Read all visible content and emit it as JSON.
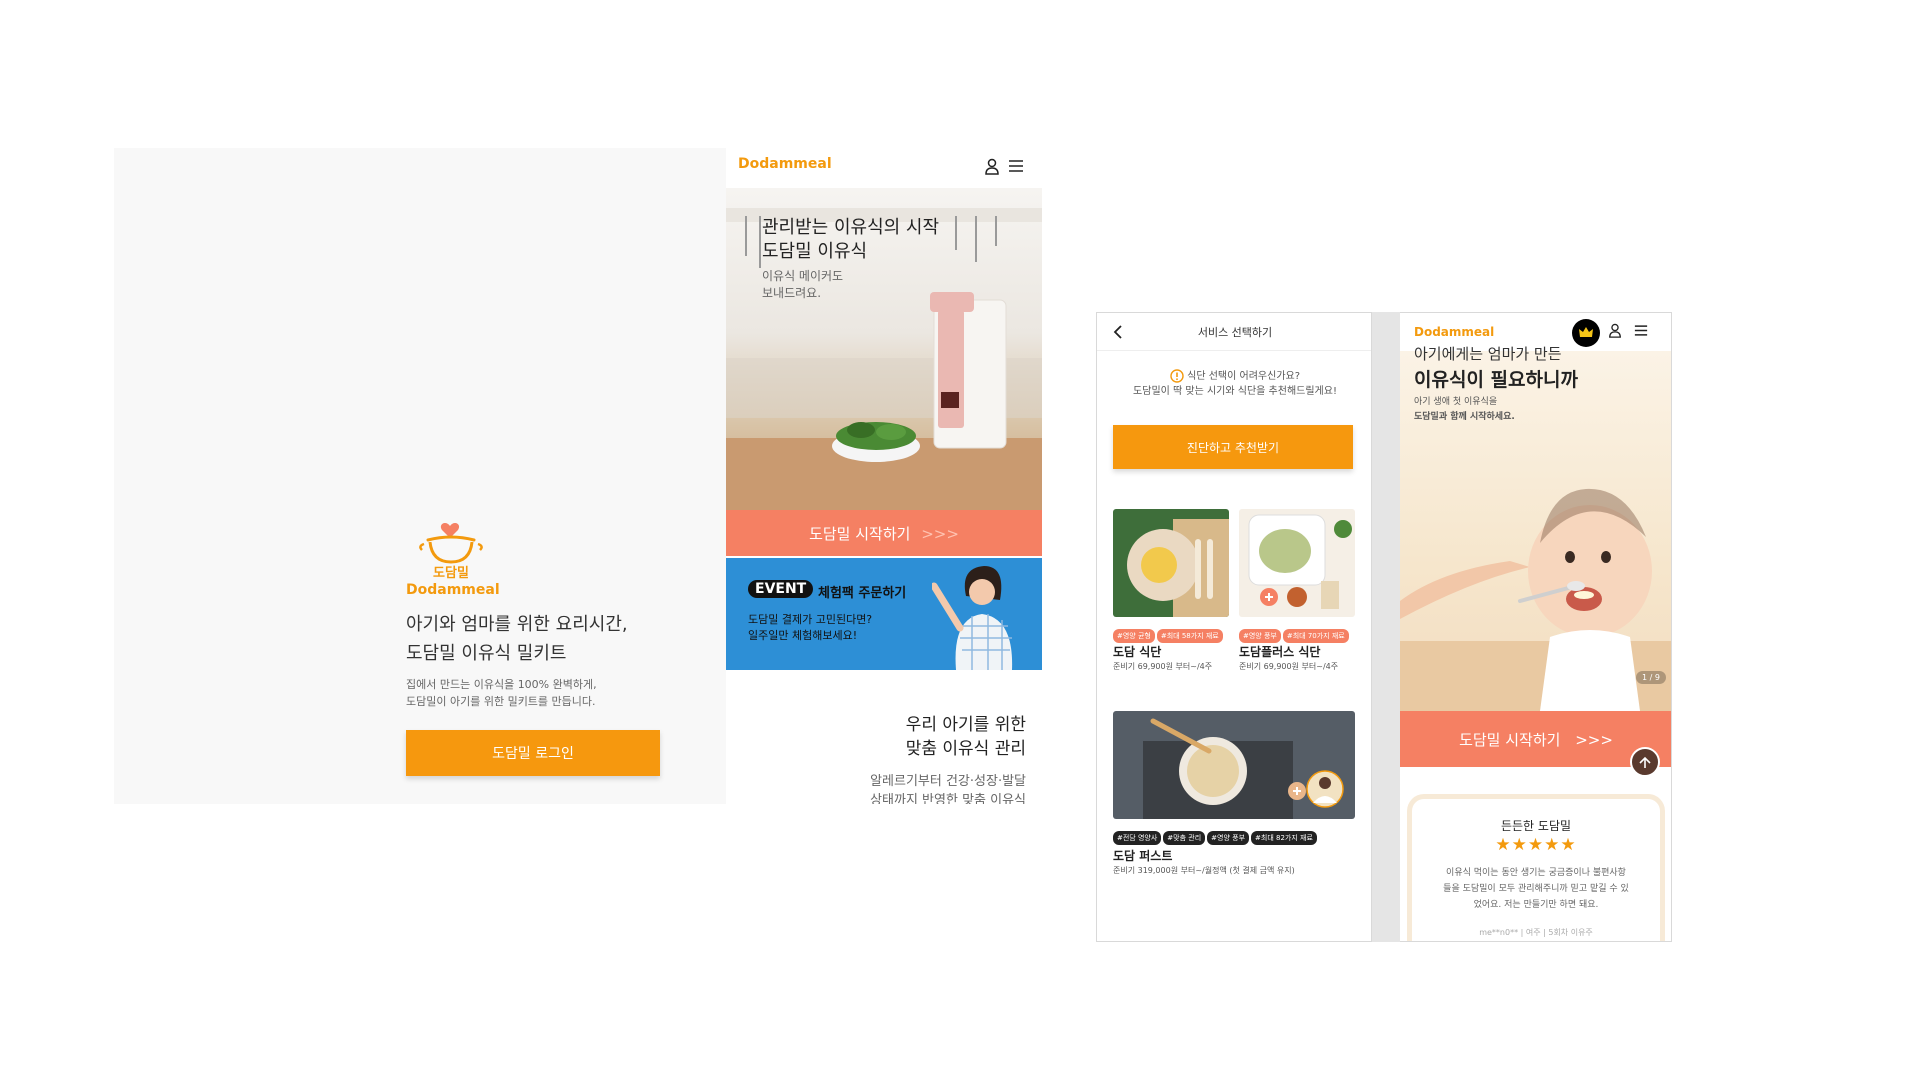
{
  "landing": {
    "brand": "Dodammeal",
    "logo_text": "도담밀",
    "headline_1": "아기와 엄마를 위한 요리시간,",
    "headline_2": "도담밀 이유식 밀키트",
    "desc_1": "집에서 만드는 이유식을 100% 완벽하게,",
    "desc_2": "도담밀이 아기를 위한 밀키트를 만듭니다.",
    "login_label": "도담밀 로그인"
  },
  "home": {
    "brand": "Dodammeal",
    "hero_title_1": "관리받는 이유식의 시작",
    "hero_title_2": "도담밀 이유식",
    "hero_sub_1": "이유식 메이커도",
    "hero_sub_2": "보내드려요.",
    "start_label": "도담밀 시작하기",
    "start_arrows": ">>>",
    "event_badge": "EVENT",
    "event_title": "체험팩 주문하기",
    "event_text_1": "도담밀 결제가 고민된다면?",
    "event_text_2": "일주일만 체험해보세요!",
    "manage_title_1": "우리 아기를 위한",
    "manage_title_2": "맞춤 이유식 관리",
    "manage_desc_1": "알레르기부터 건강·성장·발달",
    "manage_desc_2": "상태까지 반영한 맞춤 이유식"
  },
  "service": {
    "title": "서비스 선택하기",
    "warn_1": "식단 선택이 어려우신가요?",
    "warn_2": "도담밀이 딱 맞는 시기와 식단을 추천해드릴게요!",
    "diag_label": "진단하고 추천받기",
    "cards": [
      {
        "name": "도담 식단",
        "price": "준비기 69,900원 부터~/4주",
        "tags": [
          "#영양 균형",
          "#최대 58가지 재료"
        ]
      },
      {
        "name": "도담플러스 식단",
        "price": "준비기 69,900원 부터~/4주",
        "tags": [
          "#영양 풍부",
          "#최대 70가지 재료"
        ]
      },
      {
        "name": "도담 퍼스트",
        "price": "준비기 319,000원 부터~/월정액 (첫 결제 금액 유지)",
        "tags": [
          "#전담 영양사",
          "#맞춤 관리",
          "#영양 풍부",
          "#최대 82가지 재료"
        ]
      }
    ]
  },
  "home2": {
    "brand": "Dodammeal",
    "title_1": "아기에게는 엄마가 만든",
    "title_2": "이유식이 필요하니까",
    "sub_1": "아기 생애 첫 이유식을",
    "sub_2": "도담밀과 함께 시작하세요.",
    "page_indicator": "1 / 9",
    "start_label": "도담밀 시작하기",
    "start_arrows": ">>>",
    "review_title": "든든한 도담밀",
    "stars": "★★★★★",
    "review_1": "이유식 먹이는 동안 생기는 궁금증이나 불편사항",
    "review_2": "들을 도담밀이 모두 관리해주니까 믿고 맡길 수 있",
    "review_3": "었어요. 저는 만들기만 하면 돼요.",
    "review_meta": "me**n0**  |  여주  |  5회차 이유주"
  }
}
